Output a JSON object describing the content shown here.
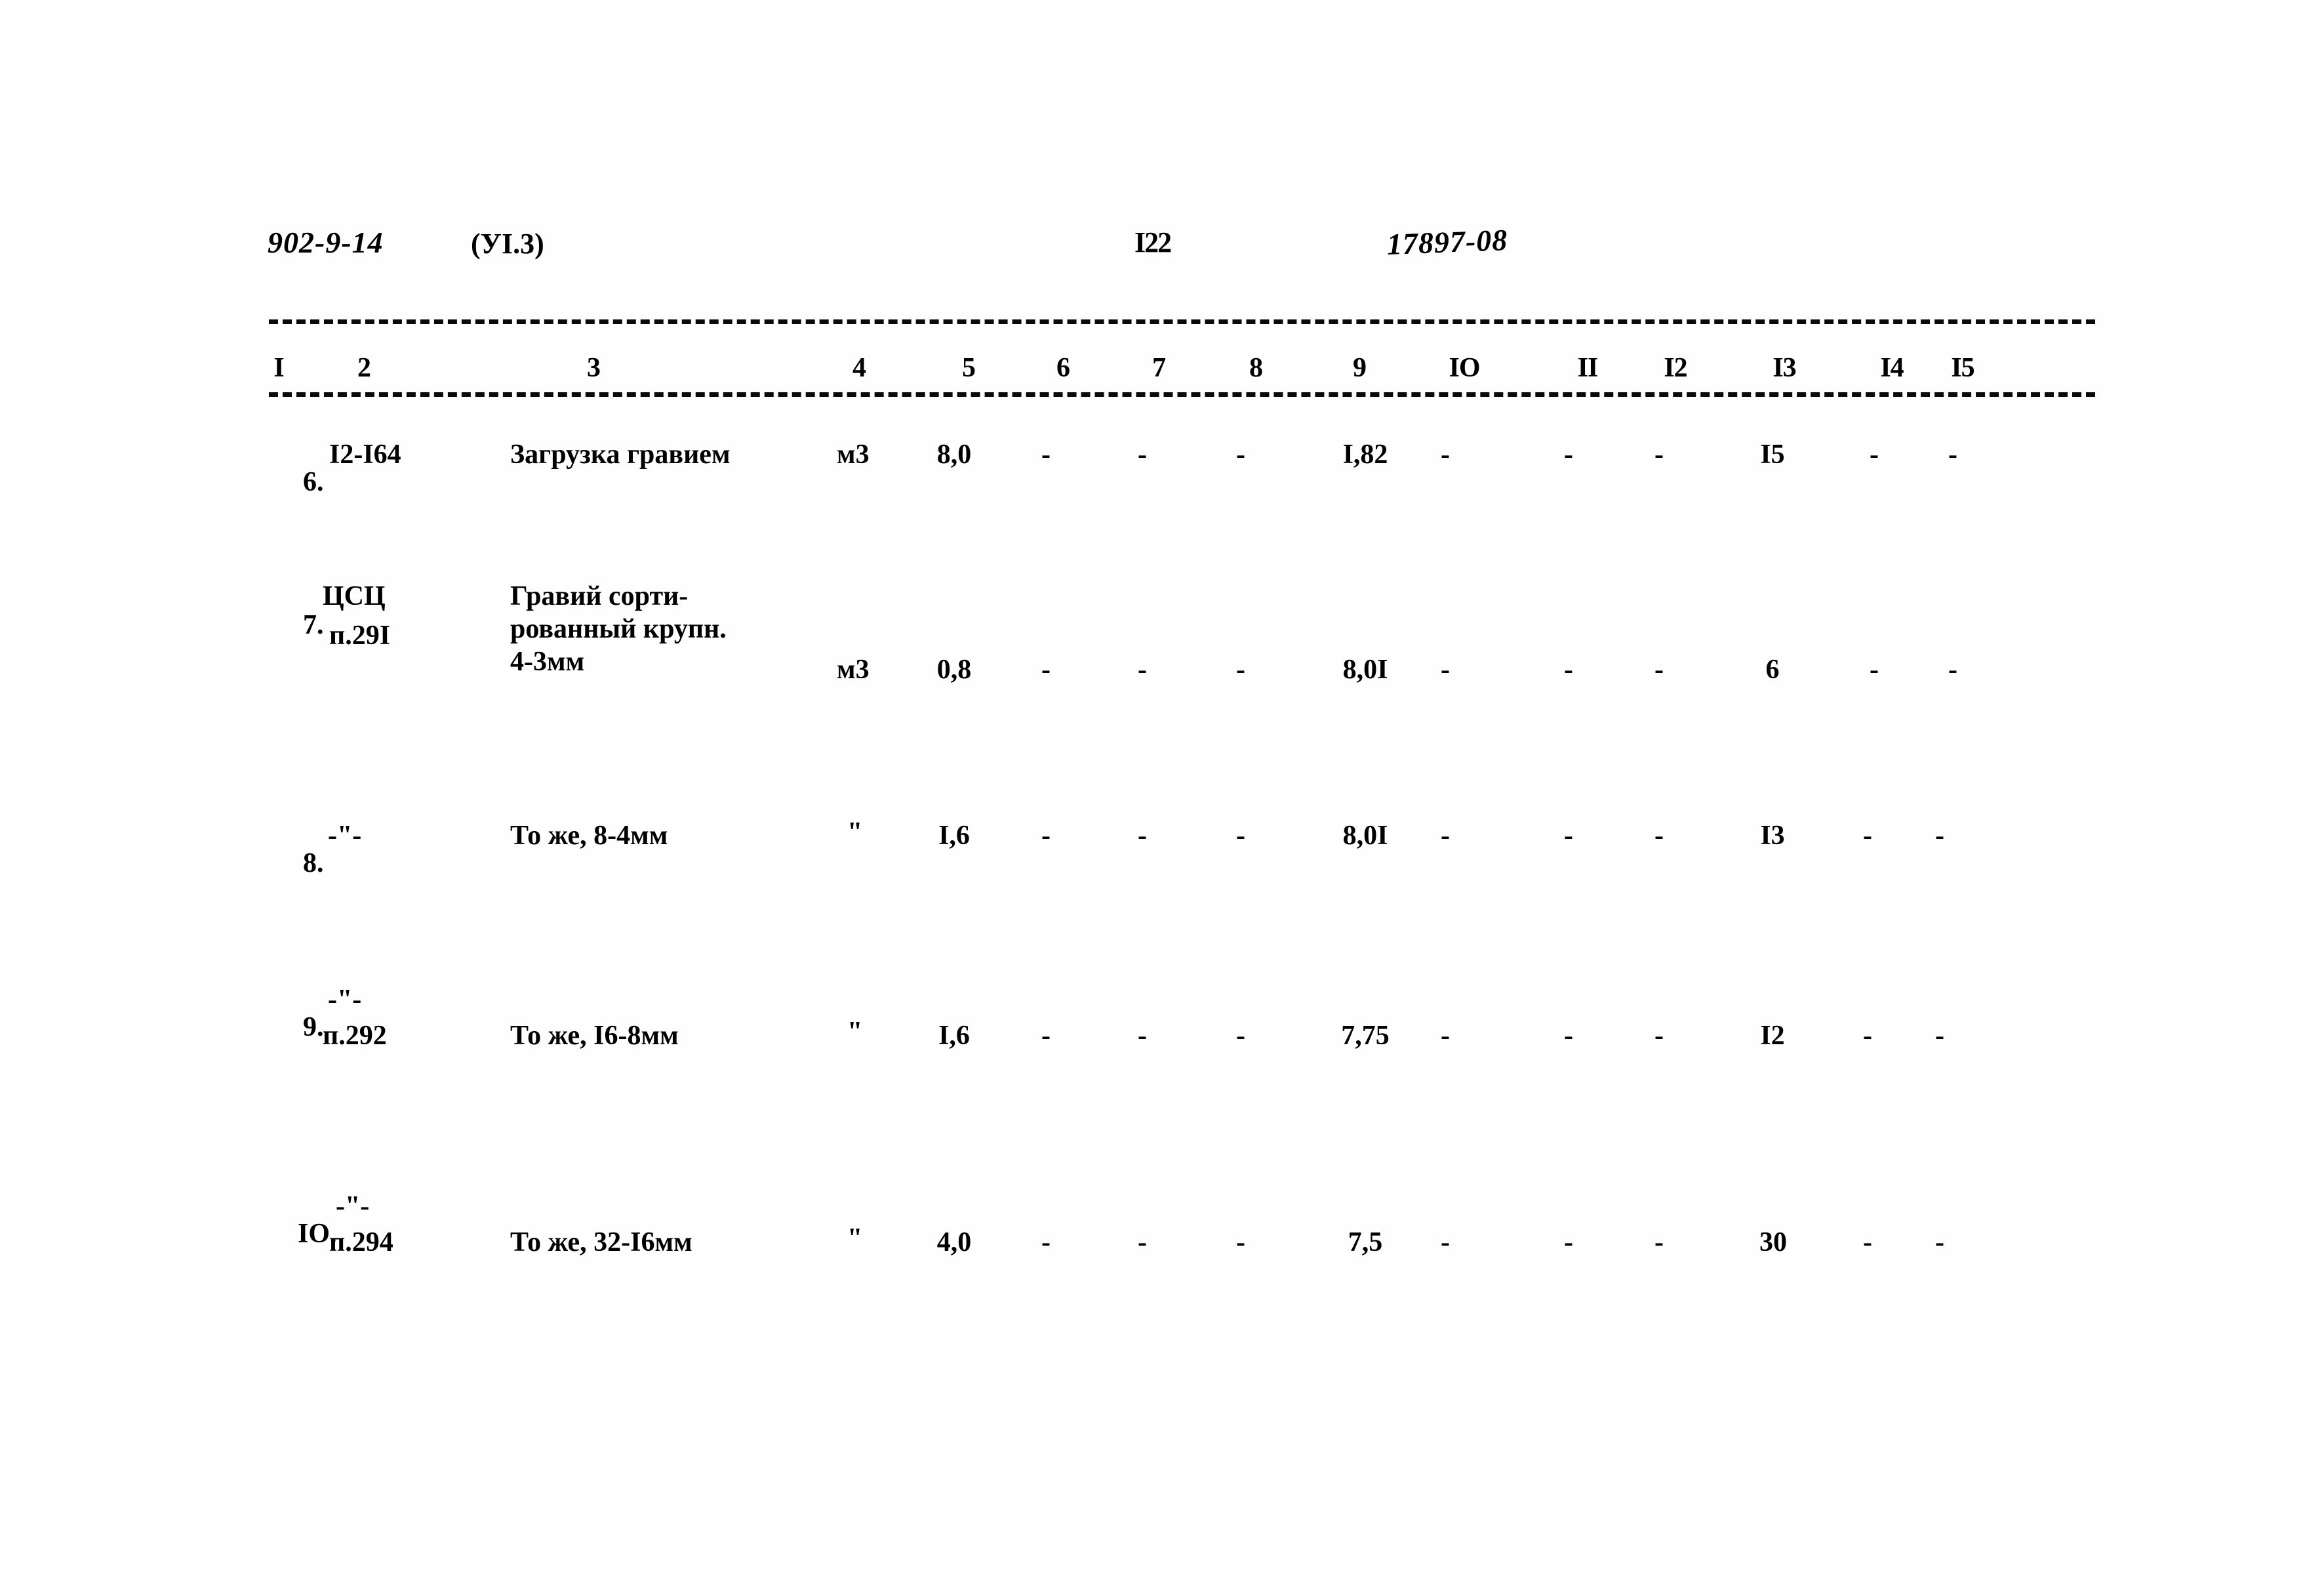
{
  "header": {
    "doc_code": "902-9-14",
    "section": "(УI.3)",
    "page_number": "I22",
    "stamp": "17897-08"
  },
  "table": {
    "column_numbers": [
      "I",
      "2",
      "3",
      "4",
      "5",
      "6",
      "7",
      "8",
      "9",
      "IO",
      "II",
      "I2",
      "I3",
      "I4",
      "I5"
    ],
    "rows": [
      {
        "no": "6.",
        "code": "I2-I64",
        "code2": "",
        "desc_line1": "Загрузка гравием",
        "desc_line2": "",
        "desc_line3": "",
        "unit": "м3",
        "c5": "8,0",
        "c6": "-",
        "c7": "-",
        "c8": "-",
        "c9": "I,82",
        "c10": "-",
        "c11": "-",
        "c12": "-",
        "c13": "I5",
        "c14": "-",
        "c15": "-"
      },
      {
        "no": "7.",
        "code": "ЦСЦ",
        "code2": "п.29I",
        "desc_line1": "Гравий сорти-",
        "desc_line2": "рованный крупн.",
        "desc_line3": "4-3мм",
        "unit": "м3",
        "c5": "0,8",
        "c6": "-",
        "c7": "-",
        "c8": "-",
        "c9": "8,0I",
        "c10": "-",
        "c11": "-",
        "c12": "-",
        "c13": "6",
        "c14": "-",
        "c15": "-"
      },
      {
        "no": "8.",
        "code": "-\"-",
        "code2": "",
        "desc_line1": "То же, 8-4мм",
        "desc_line2": "",
        "desc_line3": "",
        "unit": "\"",
        "c5": "I,6",
        "c6": "-",
        "c7": "-",
        "c8": "-",
        "c9": "8,0I",
        "c10": "-",
        "c11": "-",
        "c12": "-",
        "c13": "I3",
        "c14": "-",
        "c15": "-"
      },
      {
        "no": "9.",
        "code": "-\"-",
        "code2": "п.292",
        "desc_line1": "То же, I6-8мм",
        "desc_line2": "",
        "desc_line3": "",
        "unit": "\"",
        "c5": "I,6",
        "c6": "-",
        "c7": "-",
        "c8": "-",
        "c9": "7,75",
        "c10": "-",
        "c11": "-",
        "c12": "-",
        "c13": "I2",
        "c14": "-",
        "c15": "-"
      },
      {
        "no": "IO.",
        "code": "-\"-",
        "code2": "п.294",
        "desc_line1": "То же, 32-I6мм",
        "desc_line2": "",
        "desc_line3": "",
        "unit": "\"",
        "c5": "4,0",
        "c6": "-",
        "c7": "-",
        "c8": "-",
        "c9": "7,5",
        "c10": "-",
        "c11": "-",
        "c12": "-",
        "c13": "30",
        "c14": "-",
        "c15": "-"
      }
    ]
  }
}
